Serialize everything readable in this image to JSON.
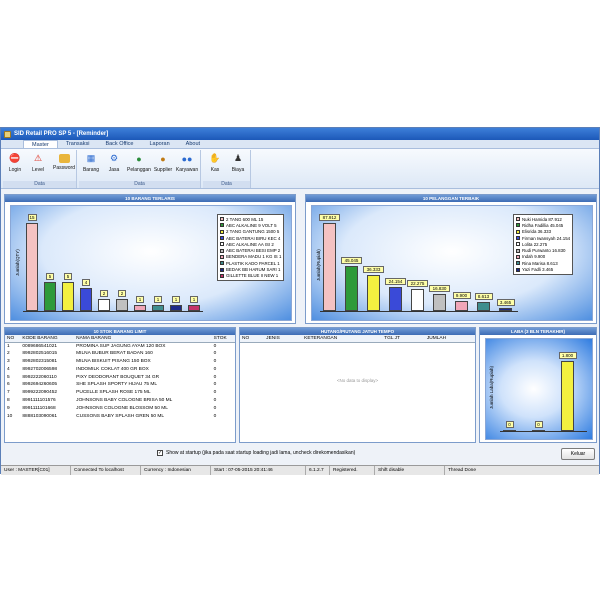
{
  "window": {
    "title": "SID Retail PRO SP 5 - [Reminder]"
  },
  "ribbon_tabs": [
    {
      "label": "Master",
      "active": true
    },
    {
      "label": "Transaksi",
      "active": false
    },
    {
      "label": "Back Office",
      "active": false
    },
    {
      "label": "Laporan",
      "active": false
    },
    {
      "label": "About",
      "active": false
    }
  ],
  "ribbon_groups": [
    {
      "label": "Data",
      "buttons": [
        {
          "label": "Login",
          "icon": "no-entry-icon"
        },
        {
          "label": "Level",
          "icon": "warning-icon"
        },
        {
          "label": "Password",
          "icon": "folder-key-icon"
        }
      ]
    },
    {
      "label": "Data",
      "buttons": [
        {
          "label": "Barang",
          "icon": "boxes-icon"
        },
        {
          "label": "Jasa",
          "icon": "tools-icon"
        },
        {
          "label": "Pelanggan",
          "icon": "customer-icon"
        },
        {
          "label": "Supplier",
          "icon": "supplier-icon"
        },
        {
          "label": "Karyawan",
          "icon": "employees-icon"
        }
      ]
    },
    {
      "label": "Data",
      "buttons": [
        {
          "label": "Kas",
          "icon": "cash-icon"
        },
        {
          "label": "Biaya",
          "icon": "cost-icon"
        }
      ]
    }
  ],
  "panels": {
    "top_items": {
      "title": "10 BARANG TERLARIS",
      "ylabel": "Jumlah(QTY)"
    },
    "top_customers": {
      "title": "10 PELANGGAN TERBAIK",
      "ylabel": "Jumlah(Rupiah)"
    },
    "min_stock": {
      "title": "10 STOK BARANG LIMIT"
    },
    "debts": {
      "title": "HUTANG/PIUTANG JATUH TEMPO",
      "no_data": "<No data to display>"
    },
    "profit": {
      "title": "LABA (3 BLN TERAKHIR)",
      "ylabel": "Jumlah Laba(Rupiah)"
    }
  },
  "chart_data": [
    {
      "type": "bar",
      "title": "10 BARANG TERLARIS",
      "ylabel": "Jumlah(QTY)",
      "categories": [
        "2 TANG 600 ML 15",
        "ABC ALKALINE 9 VOLT 5",
        "2 TANG GANTUNG 1500 5",
        "ABC BATERAI BIRU KEC 4",
        "ABC ALKALINE AA ISI 2",
        "ABC BATERAI BESI EMP 2",
        "BENDERA MADU 1 KG IS 1",
        "PLASTIK KADO PARCEL 1",
        "BEDAK BB HARUM SARI 1",
        "GILLETTE BLUE II NEW 1"
      ],
      "values": [
        15,
        5,
        5,
        4,
        2,
        2,
        1,
        1,
        1,
        1
      ],
      "value_labels": [
        "15",
        "5",
        "5",
        "4",
        "2",
        "2",
        "1",
        "1",
        "1",
        "1"
      ],
      "colors": [
        "#f4c2c2",
        "#2e9a3a",
        "#f3f040",
        "#3a4ad8",
        "#ffffff",
        "#c0c0c0",
        "#f0a6b8",
        "#3f8e8e",
        "#1d2a8a",
        "#c4346a"
      ],
      "legend": "right"
    },
    {
      "type": "bar",
      "title": "10 PELANGGAN TERBAIK",
      "ylabel": "Jumlah(Rupiah)",
      "categories": [
        "Nuki Hamida 87.912",
        "Ridha Fadillia 45.045",
        "Elisrida 36.333",
        "Firman Iwansyah 24.154",
        "Lolita 22.275",
        "Rudi Purwanto 16.830",
        "Indah 9.900",
        "Rina Marisa 8.613",
        "Yazi Fadli 3.465"
      ],
      "values": [
        87912,
        45045,
        36333,
        24154,
        22275,
        16830,
        9900,
        8613,
        3465
      ],
      "value_labels": [
        "87.912",
        "45.045",
        "36.333",
        "24.154",
        "22.275",
        "16.830",
        "9.900",
        "8.613",
        "3.465"
      ],
      "colors": [
        "#f4c2c2",
        "#2e9a3a",
        "#f3f040",
        "#3a4ad8",
        "#ffffff",
        "#c0c0c0",
        "#f0a6b8",
        "#3f8e8e",
        "#1d2a8a"
      ],
      "legend": "right"
    },
    {
      "type": "bar",
      "title": "LABA (3 BLN TERAKHIR)",
      "ylabel": "Jumlah Laba(Rupiah)",
      "categories": [
        "",
        "",
        ""
      ],
      "values": [
        0,
        0,
        1800
      ],
      "value_labels": [
        "0",
        "0",
        "1.800"
      ],
      "colors": [
        "#ffffff",
        "#ffffff",
        "#f3f040"
      ]
    }
  ],
  "stock_table": {
    "columns": [
      "NO",
      "KODE BARANG",
      "NAMA BARANG",
      "STOK"
    ],
    "rows": [
      [
        "1",
        "0089686541021",
        "PROMINA SUP JAGUNG AYAM 120 BOX",
        "0"
      ],
      [
        "2",
        "8992802516015",
        "MILNA BUBUR BERAT BADAN 160",
        "0"
      ],
      [
        "3",
        "8992802315081",
        "MILNA BISKUIT PISANG 150 BOX",
        "0"
      ],
      [
        "4",
        "8992702006598",
        "INDOMILK COKLAT 400 GR BOX",
        "0"
      ],
      [
        "5",
        "8992222060110",
        "PIXY DEODORANT BOUQUET 34 GR",
        "0"
      ],
      [
        "6",
        "8992694260605",
        "SHE SPLASH SPORTY HIJAU 75 ML",
        "0"
      ],
      [
        "7",
        "8999222090452",
        "PUCELLE SPLASH ROSE 175 ML",
        "0"
      ],
      [
        "8",
        "8991111101576",
        "JOHNSONS BABY COLOGNE BRISA 50 ML",
        "0"
      ],
      [
        "9",
        "8991111101668",
        "JOHNSONS COLOGNE BLOSSOM 50 ML",
        "0"
      ],
      [
        "10",
        "8888103090061",
        "CUSSONS BABY SPLASH GREN 50 ML",
        "0"
      ]
    ]
  },
  "debt_table": {
    "columns": [
      "NO",
      "JENIS",
      "KETERANGAN",
      "TGL JT",
      "JUMLAH"
    ]
  },
  "startup_checkbox": {
    "checked": true,
    "label": "Show at startup (jika pada saat startup loading jadi lama, uncheck direkomendasikan)"
  },
  "keluar_button": "Keluar",
  "status_bar": [
    "User : MASTER[C01]",
    "Connected To localhost",
    "Currency : Indonesian",
    "Start : 07-05-2015 20:41:46",
    "6.1.2.7",
    "Registered.",
    "Shift disable",
    "Thread Done"
  ]
}
